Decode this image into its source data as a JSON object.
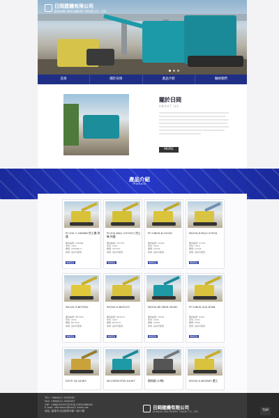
{
  "header": {
    "company": "日岡建機有限公司",
    "company_en": "JIHKANG MACHINERY TRADE CO., LTD"
  },
  "nav": {
    "items": [
      "首頁",
      "關於日岡",
      "產品介紹",
      "聯絡我們"
    ]
  },
  "about": {
    "title": "關於日岡",
    "title_en": "ABOUT US",
    "more": "MORE"
  },
  "products": {
    "title": "產品介紹",
    "title_en": "Products",
    "items": [
      {
        "name": "PC100-7-206986 挖土機 附鐵",
        "spec1": "機身編號: 206986",
        "spec2": "年份: 2005",
        "spec3": "機號: 206986(7)",
        "spec4": "狀態: 良好可使用",
        "btn": "瞭解更多"
      },
      {
        "name": "PC200-6N(1-207007) 挖土機 附鐵",
        "spec1": "機身編號: 207007",
        "spec2": "年份: 2004",
        "spec3": "機號: 207007",
        "spec4": "狀態: 良好可使用",
        "btn": "瞭解更多"
      },
      {
        "name": "PC138US-8-22026",
        "spec1": "機身編號: 22026",
        "spec2": "年份: 2009",
        "spec3": "機號: 22026",
        "spec4": "狀態: 良好可使用",
        "btn": "瞭解更多"
      },
      {
        "name": "SK200-8-YN12-57934",
        "spec1": "機身編號: 57934",
        "spec2": "年份: 2010",
        "spec3": "機號: 57934",
        "spec4": "狀態: 良好可使用",
        "btn": "瞭解更多"
      },
      {
        "name": "SH120-3-BH7902",
        "spec1": "機身編號: BH7902",
        "spec2": "年份: 2004",
        "spec3": "機號: BH7902",
        "spec4": "狀態: 良好可使用",
        "btn": "瞭解更多"
      },
      {
        "name": "SH200-5-BH3223",
        "spec1": "機身編號: BH3223",
        "spec2": "年份: 2007",
        "spec3": "機號: BH3223",
        "spec4": "狀態: 良好可使用",
        "btn": "瞭解更多"
      },
      {
        "name": "SK200-6E-YN09-39281",
        "spec1": "機身編號: 39281",
        "spec2": "年份: 2006",
        "spec3": "機號: 39281",
        "spec4": "狀態: 良好可使用",
        "btn": "瞭解更多"
      },
      {
        "name": "PC138US-2(S)-8496",
        "spec1": "機身編號: 8496",
        "spec2": "年份: 2003",
        "spec3": "機號: 8496",
        "spec4": "狀態: 良好可使用",
        "btn": "瞭解更多"
      },
      {
        "name": "D31P-18-44363",
        "spec1": "",
        "spec2": "",
        "spec3": "",
        "spec4": "",
        "btn": ""
      },
      {
        "name": "SK135SR-YY05-04497",
        "spec1": "",
        "spec2": "",
        "spec3": "",
        "spec4": "",
        "btn": ""
      },
      {
        "name": "鋼絲鉗(10噸)",
        "spec1": "",
        "spec2": "",
        "spec3": "",
        "spec4": "",
        "btn": ""
      },
      {
        "name": "SH200-5-BH2863 農工",
        "spec1": "",
        "spec2": "",
        "spec3": "",
        "spec4": "",
        "btn": ""
      }
    ]
  },
  "footer": {
    "tel": "TEL: +886(0)7-3528287",
    "fax": "FAX: +886(0)7-3528337",
    "mobile": "H/P: +886(0)935782308 /0933488461",
    "email": "E-mail: nfkiramen@ms21.hinet.net",
    "address": "地址: 高雄市大社區和平路一段22號",
    "company": "日岡建機有限公司",
    "company_en": "JIHKANG MACHINERY TRADE CO., LTD",
    "top": "TOP"
  },
  "colors": {
    "nav": "#1f2f86",
    "band": "#2638c9",
    "button": "#2a3a9a",
    "footer": "#3a3a3a"
  }
}
